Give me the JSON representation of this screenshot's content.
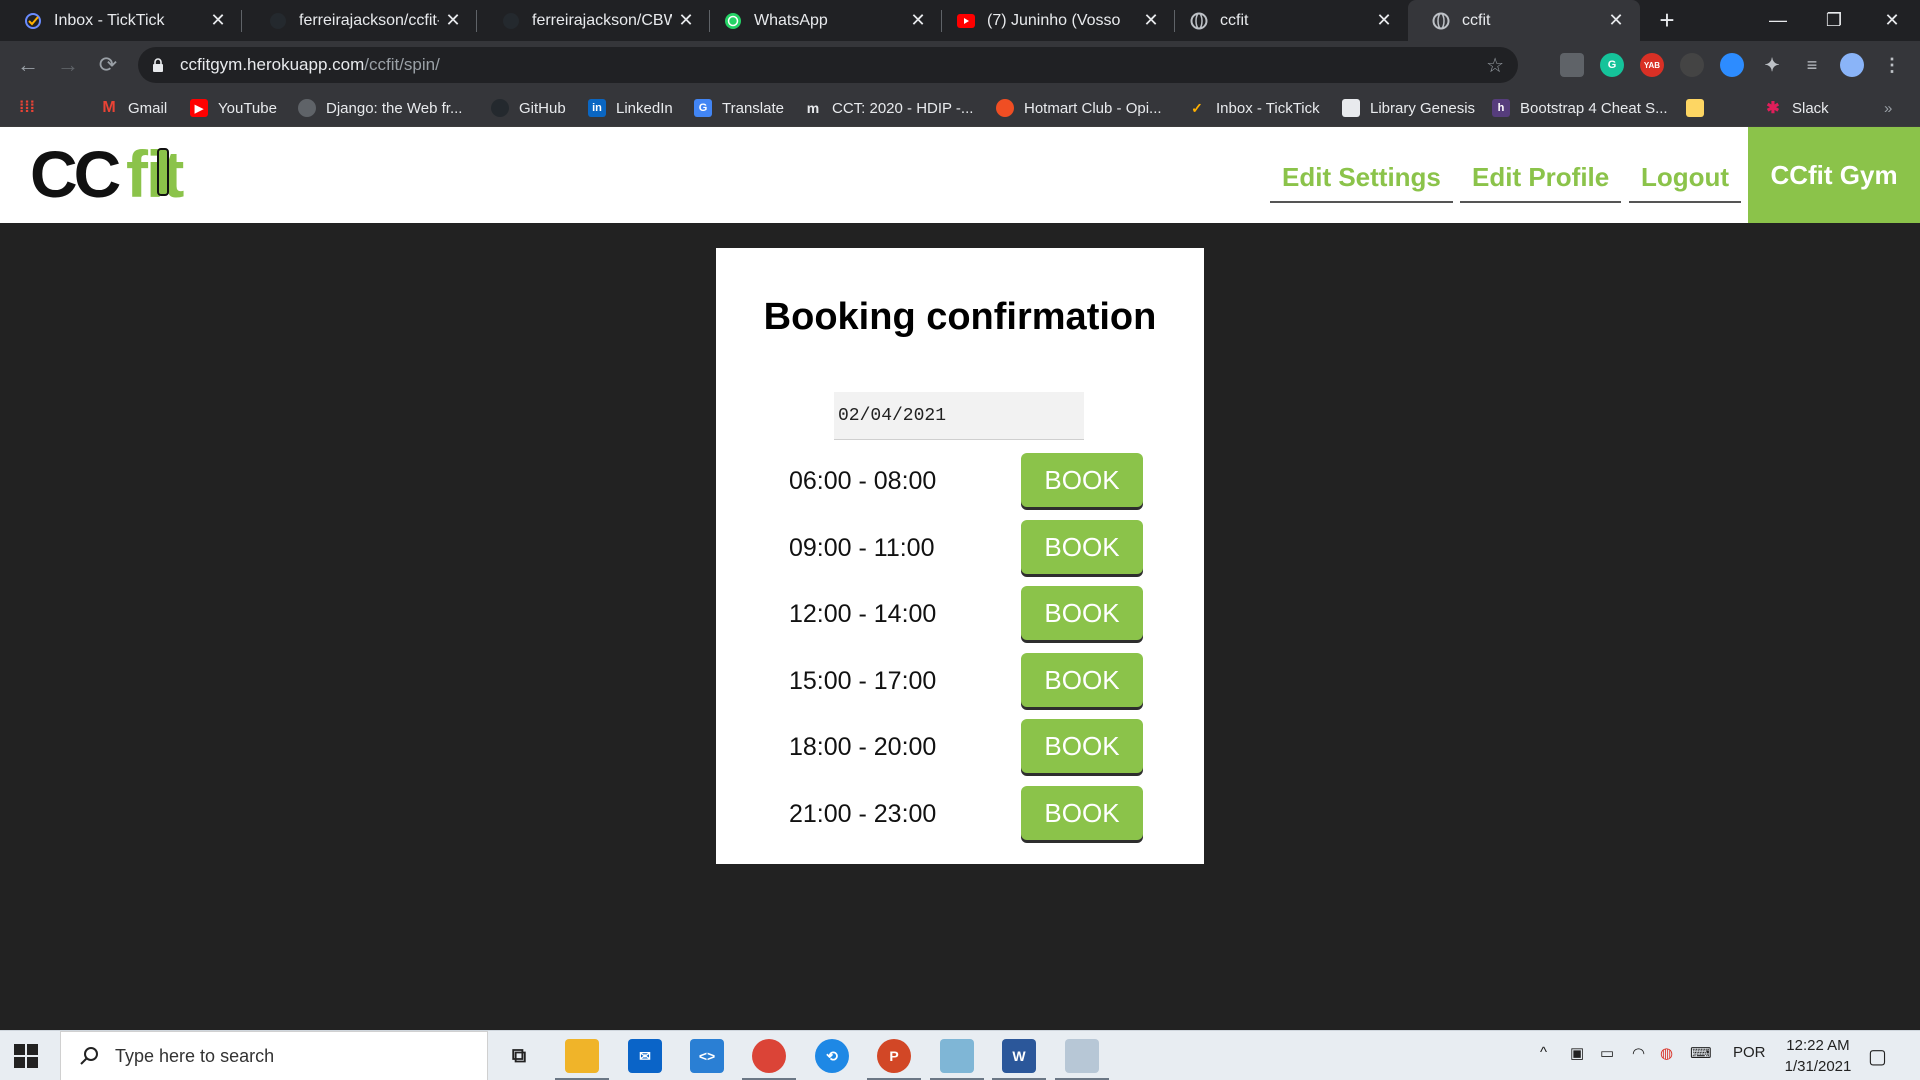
{
  "browser": {
    "tabs": [
      {
        "title": "Inbox - TickTick",
        "icon": "ticktick-icon",
        "active": false
      },
      {
        "title": "ferreirajackson/ccfit-liv",
        "icon": "github-icon",
        "active": false
      },
      {
        "title": "ferreirajackson/CBWA-",
        "icon": "github-icon",
        "active": false
      },
      {
        "title": "WhatsApp",
        "icon": "whatsapp-icon",
        "active": false
      },
      {
        "title": "(7) Juninho (Vosso",
        "icon": "youtube-icon",
        "active": false
      },
      {
        "title": "ccfit",
        "icon": "globe-icon",
        "active": false
      },
      {
        "title": "ccfit",
        "icon": "globe-icon",
        "active": true
      }
    ],
    "url_host": "ccfitgym.herokuapp.com",
    "url_path": "/ccfit/spin/",
    "bookmarks": [
      {
        "label": "",
        "icon": "apps-grid-icon"
      },
      {
        "label": "Gmail",
        "icon": "gmail-icon"
      },
      {
        "label": "YouTube",
        "icon": "youtube-icon"
      },
      {
        "label": "Django: the Web fr...",
        "icon": "globe-icon"
      },
      {
        "label": "GitHub",
        "icon": "github-icon"
      },
      {
        "label": "LinkedIn",
        "icon": "linkedin-icon"
      },
      {
        "label": "Translate",
        "icon": "translate-icon"
      },
      {
        "label": "CCT: 2020 - HDIP -...",
        "icon": "moodle-icon"
      },
      {
        "label": "Hotmart Club - Opi...",
        "icon": "hotmart-icon"
      },
      {
        "label": "Inbox - TickTick",
        "icon": "ticktick-icon"
      },
      {
        "label": "Library Genesis",
        "icon": "book-icon"
      },
      {
        "label": "Bootstrap 4 Cheat S...",
        "icon": "bootstrap-icon"
      },
      {
        "label": "",
        "icon": "folder-icon"
      },
      {
        "label": "Slack",
        "icon": "slack-icon"
      }
    ],
    "colors": {
      "frame": "#202124",
      "toolbar": "#35363a"
    }
  },
  "site": {
    "logo_text_dark": "CC",
    "logo_text_green": "fit",
    "nav": [
      "Edit Settings",
      "Edit Profile",
      "Logout"
    ],
    "brand": "CCfit Gym",
    "accent": "#8bc34a"
  },
  "booking": {
    "title": "Booking confirmation",
    "date": "02/04/2021",
    "book_label": "BOOK",
    "slots": [
      "06:00 - 08:00",
      "09:00 - 11:00",
      "12:00 - 14:00",
      "15:00 - 17:00",
      "18:00 - 20:00",
      "21:00 - 23:00"
    ]
  },
  "taskbar": {
    "search_placeholder": "Type here to search",
    "apps": [
      "task-view-icon",
      "file-explorer-icon",
      "mail-icon",
      "vscode-icon",
      "chrome-icon",
      "app-icon",
      "powerpoint-icon",
      "notes-icon",
      "word-icon",
      "paint-icon"
    ],
    "language": "POR",
    "time": "12:22 AM",
    "date": "1/31/2021"
  }
}
